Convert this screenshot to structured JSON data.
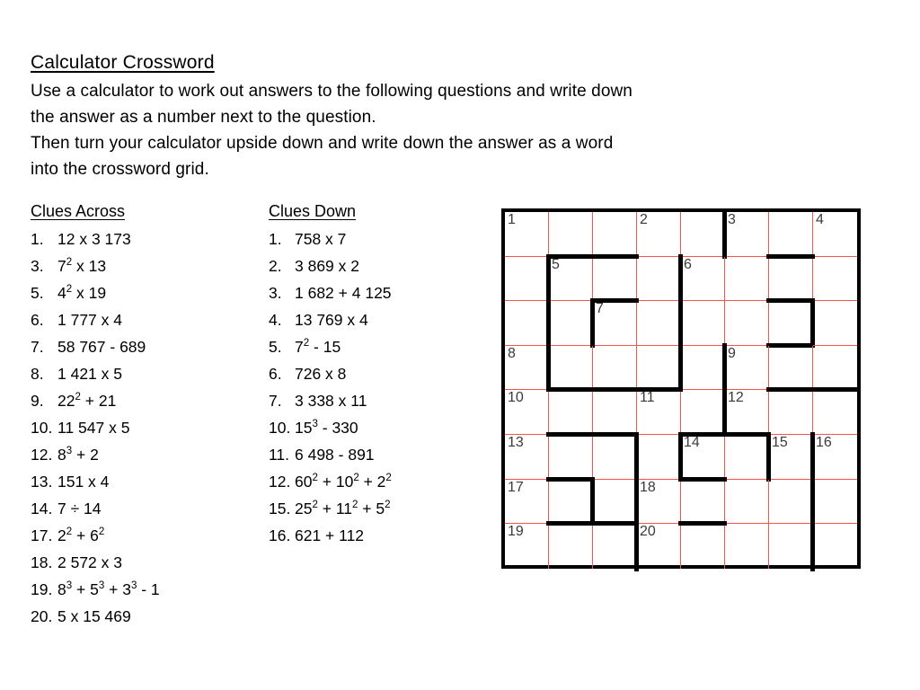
{
  "header": {
    "title": "Calculator Crossword",
    "intro_lines": [
      "Use a calculator to work out answers to the following questions and write down",
      "the answer as a number next to the question.",
      "Then turn your calculator upside down and write down the answer as a word",
      "into the crossword grid."
    ]
  },
  "across": {
    "heading": "Clues Across",
    "clues": [
      {
        "num": "1.",
        "text_html": "12 x 3 173"
      },
      {
        "num": "3.",
        "text_html": "7<sup>2</sup> x 13"
      },
      {
        "num": "5.",
        "text_html": "4<sup>2</sup> x 19"
      },
      {
        "num": "6.",
        "text_html": "1 777 x 4"
      },
      {
        "num": "7.",
        "text_html": "58 767 - 689"
      },
      {
        "num": "8.",
        "text_html": "1 421 x 5"
      },
      {
        "num": "9.",
        "text_html": "22<sup>2</sup> + 21"
      },
      {
        "num": "10.",
        "text_html": "11 547 x 5"
      },
      {
        "num": "12.",
        "text_html": "8<sup>3</sup> + 2"
      },
      {
        "num": "13.",
        "text_html": "151 x 4"
      },
      {
        "num": "14.",
        "text_html": "7 &divide; 14"
      },
      {
        "num": "17.",
        "text_html": "2<sup>2</sup> + 6<sup>2</sup>"
      },
      {
        "num": "18.",
        "text_html": "2 572 x 3"
      },
      {
        "num": "19.",
        "text_html": "8<sup>3</sup> + 5<sup>3</sup> + 3<sup>3</sup> - 1"
      },
      {
        "num": "20.",
        "text_html": "5 x 15 469"
      }
    ]
  },
  "down": {
    "heading": "Clues Down",
    "clues": [
      {
        "num": "1.",
        "text_html": "758 x 7"
      },
      {
        "num": "2.",
        "text_html": "3 869 x 2"
      },
      {
        "num": "3.",
        "text_html": "1 682 + 4 125"
      },
      {
        "num": "4.",
        "text_html": "13 769 x 4"
      },
      {
        "num": "5.",
        "text_html": "7<sup>2</sup> - 15"
      },
      {
        "num": "6.",
        "text_html": "726 x 8"
      },
      {
        "num": "7.",
        "text_html": "3 338 x 11"
      },
      {
        "num": "10.",
        "text_html": "15<sup>3</sup> - 330"
      },
      {
        "num": "11.",
        "text_html": "6 498 - 891"
      },
      {
        "num": "12.",
        "text_html": "60<sup>2</sup> + 10<sup>2</sup> + 2<sup>2</sup>"
      },
      {
        "num": "15.",
        "text_html": "25<sup>2</sup> + 11<sup>2</sup> + 5<sup>2</sup>"
      },
      {
        "num": "16.",
        "text_html": "621 + 112"
      }
    ]
  },
  "grid": {
    "rows": 8,
    "cols": 8,
    "gridline_color": "#f4564b",
    "block_color": "#000000",
    "cells": [
      [
        {
          "num": "1"
        },
        {},
        {},
        {
          "num": "2"
        },
        {},
        {
          "num": "3",
          "edges": "l"
        },
        {},
        {
          "num": "4"
        }
      ],
      [
        {},
        {
          "num": "5",
          "edges": "lt"
        },
        {
          "edges": "t"
        },
        {},
        {
          "num": "6",
          "edges": "l"
        },
        {},
        {
          "edges": "t"
        },
        {}
      ],
      [
        {},
        {
          "edges": "l"
        },
        {
          "num": "7",
          "edges": "lt"
        },
        {},
        {
          "edges": "l"
        },
        {},
        {
          "edges": "trb"
        },
        {}
      ],
      [
        {
          "num": "8"
        },
        {
          "edges": "lb"
        },
        {
          "edges": "b"
        },
        {},
        {
          "edges": "l"
        },
        {
          "num": "9",
          "edges": "l"
        },
        {},
        {}
      ],
      [
        {
          "num": "10"
        },
        {
          "edges": "t"
        },
        {
          "edges": "t"
        },
        {
          "num": "11",
          "edges": "t"
        },
        {},
        {
          "num": "12",
          "edges": "l"
        },
        {
          "edges": "t"
        },
        {
          "edges": "t"
        }
      ],
      [
        {
          "num": "13"
        },
        {
          "edges": "t"
        },
        {
          "edges": "t"
        },
        {
          "edges": "l"
        },
        {
          "num": "14",
          "edges": "lt"
        },
        {
          "edges": "t"
        },
        {
          "num": "15",
          "edges": "l"
        },
        {
          "num": "16",
          "edges": "l"
        }
      ],
      [
        {
          "num": "17"
        },
        {
          "edges": "tr"
        },
        {},
        {
          "num": "18",
          "edges": "l"
        },
        {
          "edges": "t"
        },
        {},
        {},
        {
          "edges": "l"
        }
      ],
      [
        {
          "num": "19"
        },
        {
          "edges": "t"
        },
        {
          "edges": "t"
        },
        {
          "num": "20",
          "edges": "l"
        },
        {
          "edges": "t"
        },
        {},
        {},
        {
          "edges": "l"
        }
      ]
    ]
  }
}
